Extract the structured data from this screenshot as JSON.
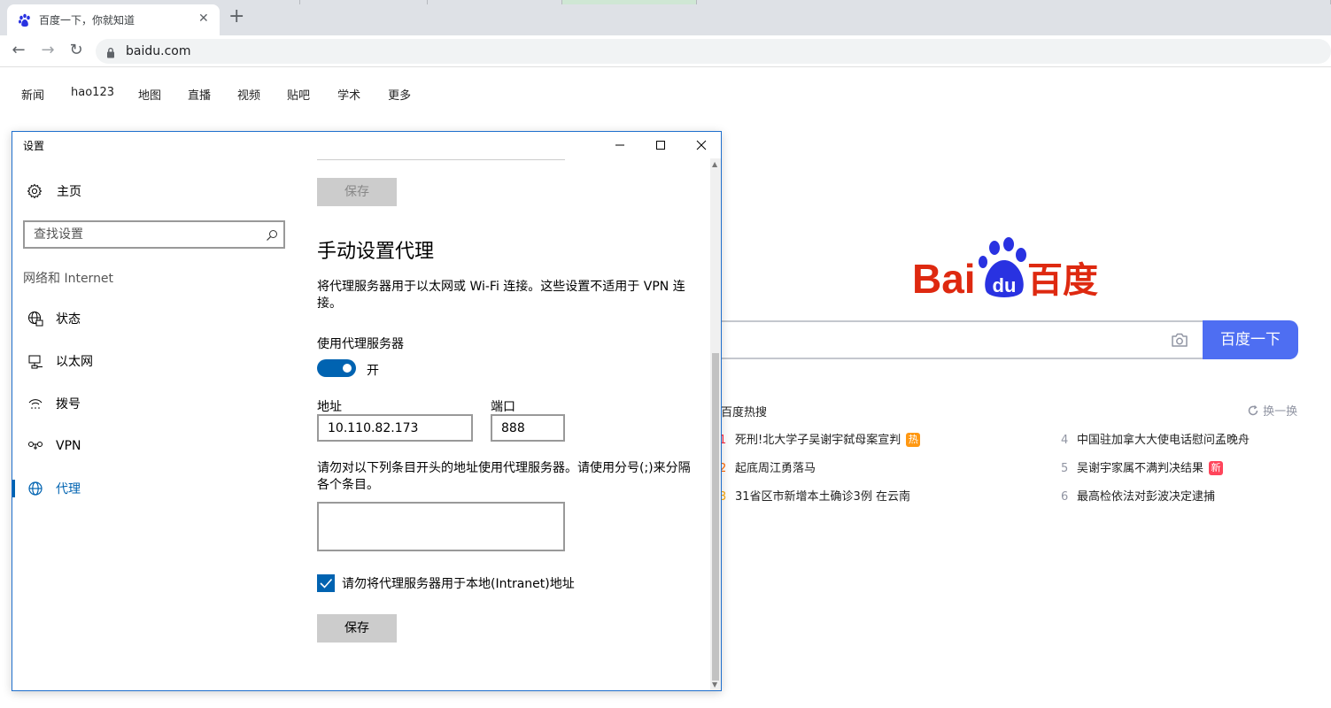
{
  "browser": {
    "tab_title": "百度一下，你就知道",
    "tab_close": "✕",
    "new_tab": "+",
    "back": "←",
    "forward": "→",
    "reload": "↻",
    "url": "baidu.com"
  },
  "baidu": {
    "nav": [
      "新闻",
      "hao123",
      "地图",
      "直播",
      "视频",
      "贴吧",
      "学术",
      "更多"
    ],
    "search_button": "百度一下",
    "logo_text_left": "Bai",
    "logo_text_paw": "du",
    "logo_text_right": "百度",
    "hot_title": "百度热搜",
    "hot_refresh": "换一换",
    "hot_list": [
      {
        "num": "1",
        "text": "死刑!北大学子吴谢宇弑母案宣判",
        "badge": "热"
      },
      {
        "num": "2",
        "text": "起底周江勇落马",
        "badge": ""
      },
      {
        "num": "3",
        "text": "31省区市新增本土确诊3例 在云南",
        "badge": ""
      },
      {
        "num": "4",
        "text": "中国驻加拿大大使电话慰问孟晚舟",
        "badge": ""
      },
      {
        "num": "5",
        "text": "吴谢宇家属不满判决结果",
        "badge": "新"
      },
      {
        "num": "6",
        "text": "最高检依法对彭波决定逮捕",
        "badge": ""
      }
    ],
    "colors": {
      "search_button": "#4e6ef2",
      "logo_red": "#de2910",
      "logo_blue": "#2932e1"
    }
  },
  "settings": {
    "window_title": "设置",
    "sidebar": {
      "home": "主页",
      "search_placeholder": "查找设置",
      "category": "网络和 Internet",
      "items": [
        {
          "label": "状态",
          "icon": "globe-network-icon"
        },
        {
          "label": "以太网",
          "icon": "ethernet-icon"
        },
        {
          "label": "拨号",
          "icon": "dialup-icon"
        },
        {
          "label": "VPN",
          "icon": "vpn-icon"
        },
        {
          "label": "代理",
          "icon": "proxy-globe-icon",
          "active": true
        }
      ]
    },
    "main": {
      "save_top": "保存",
      "heading": "手动设置代理",
      "description": "将代理服务器用于以太网或 Wi-Fi 连接。这些设置不适用于 VPN 连接。",
      "use_proxy_label": "使用代理服务器",
      "toggle_state": "开",
      "address_label": "地址",
      "address_value": "10.110.82.173",
      "port_label": "端口",
      "port_value": "888",
      "exceptions_description": "请勿对以下列条目开头的地址使用代理服务器。请使用分号(;)来分隔各个条目。",
      "exceptions_value": "",
      "bypass_local_label": "请勿将代理服务器用于本地(Intranet)地址",
      "bypass_local_checked": true,
      "save_bottom": "保存"
    },
    "colors": {
      "accent": "#0063b1",
      "window_border": "#1f6fcd"
    }
  }
}
